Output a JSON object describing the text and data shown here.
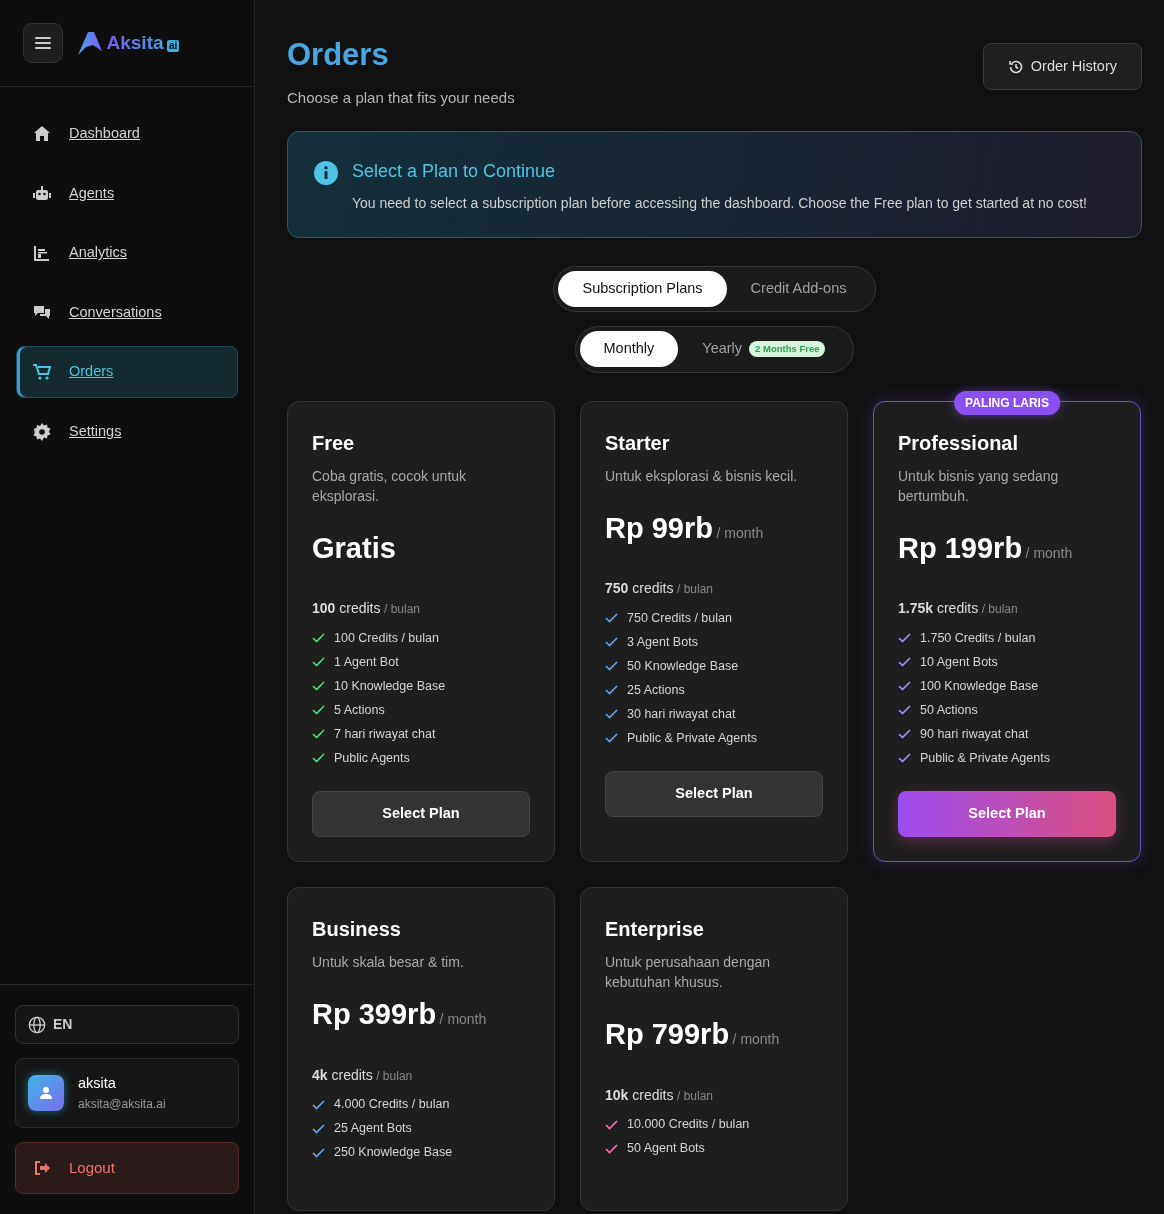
{
  "brand": {
    "name": "Aksita",
    "suffix": "ai"
  },
  "sidebar": {
    "items": [
      {
        "label": "Dashboard",
        "selected": false
      },
      {
        "label": "Agents",
        "selected": false
      },
      {
        "label": "Analytics",
        "selected": false
      },
      {
        "label": "Conversations",
        "selected": false
      },
      {
        "label": "Orders",
        "selected": true
      },
      {
        "label": "Settings",
        "selected": false
      }
    ],
    "language": "EN",
    "user": {
      "name": "aksita",
      "email": "aksita@aksita.ai"
    },
    "logout": "Logout"
  },
  "header": {
    "title": "Orders",
    "subtitle": "Choose a plan that fits your needs",
    "history_button": "Order History"
  },
  "alert": {
    "title": "Select a Plan to Continue",
    "text": "You need to select a subscription plan before accessing the dashboard. Choose the Free plan to get started at no cost!"
  },
  "tabs": [
    {
      "label": "Subscription Plans",
      "selected": true
    },
    {
      "label": "Credit Add-ons",
      "selected": false
    }
  ],
  "billing": [
    {
      "label": "Monthly",
      "selected": true
    },
    {
      "label": "Yearly",
      "selected": false,
      "badge": "2 Months Free"
    }
  ],
  "plans": [
    {
      "name": "Free",
      "description": "Coba gratis, cocok untuk eksplorasi.",
      "price": "Gratis",
      "credits": "100",
      "credits_unit": "credits",
      "credits_period": "/ bulan",
      "color": "#4ade80",
      "featured": false,
      "features": [
        "100 Credits / bulan",
        "1 Agent Bot",
        "10 Knowledge Base",
        "5 Actions",
        "7 hari riwayat chat",
        "Public Agents"
      ],
      "button": "Select Plan"
    },
    {
      "name": "Starter",
      "description": "Untuk eksplorasi & bisnis kecil.",
      "price": "Rp 99rb",
      "period": "/ month",
      "credits": "750",
      "credits_unit": "credits",
      "credits_period": "/ bulan",
      "color": "#60a5fa",
      "featured": false,
      "features": [
        "750 Credits / bulan",
        "3 Agent Bots",
        "50 Knowledge Base",
        "25 Actions",
        "30 hari riwayat chat",
        "Public & Private Agents"
      ],
      "button": "Select Plan"
    },
    {
      "name": "Professional",
      "badge": "PALING LARIS",
      "description": "Untuk bisnis yang sedang bertumbuh.",
      "price": "Rp 199rb",
      "period": "/ month",
      "credits": "1.75k",
      "credits_unit": "credits",
      "credits_period": "/ bulan",
      "color": "#a78bfa",
      "featured": true,
      "features": [
        "1.750 Credits / bulan",
        "10 Agent Bots",
        "100 Knowledge Base",
        "50 Actions",
        "90 hari riwayat chat",
        "Public & Private Agents"
      ],
      "button": "Select Plan"
    },
    {
      "name": "Business",
      "description": "Untuk skala besar & tim.",
      "price": "Rp 399rb",
      "period": "/ month",
      "credits": "4k",
      "credits_unit": "credits",
      "credits_period": "/ bulan",
      "color": "#60a5fa",
      "featured": false,
      "features": [
        "4.000 Credits / bulan",
        "25 Agent Bots",
        "250 Knowledge Base"
      ]
    },
    {
      "name": "Enterprise",
      "description": "Untuk perusahaan dengan kebutuhan khusus.",
      "price": "Rp 799rb",
      "period": "/ month",
      "credits": "10k",
      "credits_unit": "credits",
      "credits_period": "/ bulan",
      "color": "#f472b6",
      "featured": false,
      "features": [
        "10.000 Credits / bulan",
        "50 Agent Bots"
      ]
    }
  ]
}
